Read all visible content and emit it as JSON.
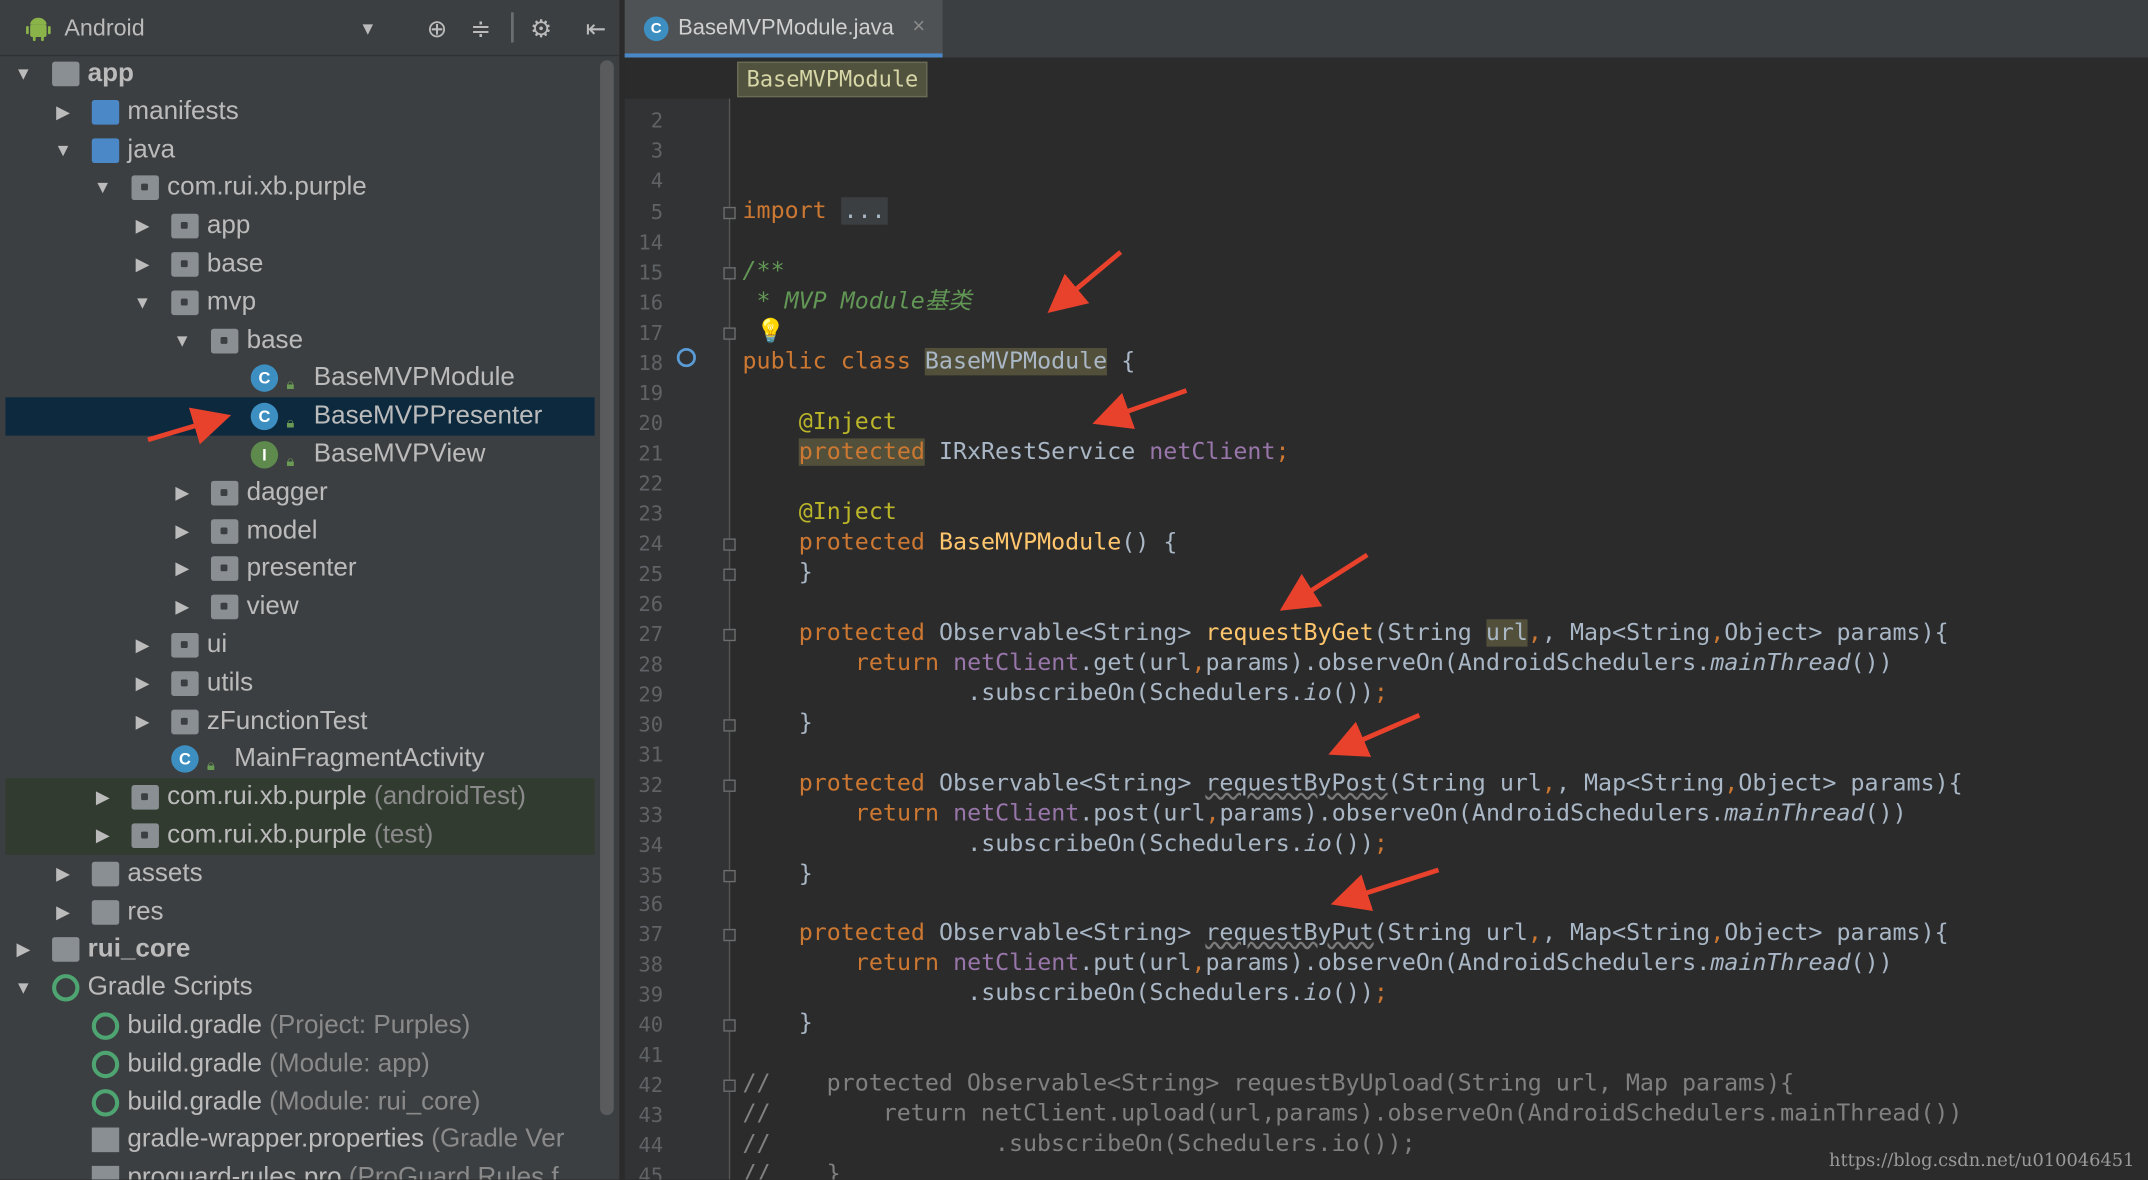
{
  "project_panel": {
    "view_mode": "Android",
    "toolbar_icons": [
      "target-icon",
      "collapse-icon",
      "gear-icon",
      "hide-panel-icon"
    ],
    "tree": [
      {
        "label": "app",
        "depth": 0,
        "arrow": "down",
        "icon": "module",
        "bold": true
      },
      {
        "label": "manifests",
        "depth": 1,
        "arrow": "right",
        "icon": "folder-blue"
      },
      {
        "label": "java",
        "depth": 1,
        "arrow": "down",
        "icon": "folder-blue"
      },
      {
        "label": "com.rui.xb.purple",
        "depth": 2,
        "arrow": "down",
        "icon": "package"
      },
      {
        "label": "app",
        "depth": 3,
        "arrow": "right",
        "icon": "package"
      },
      {
        "label": "base",
        "depth": 3,
        "arrow": "right",
        "icon": "package"
      },
      {
        "label": "mvp",
        "depth": 3,
        "arrow": "down",
        "icon": "package"
      },
      {
        "label": "base",
        "depth": 4,
        "arrow": "down",
        "icon": "package"
      },
      {
        "label": "BaseMVPModule",
        "depth": 5,
        "arrow": "",
        "icon": "class-c"
      },
      {
        "label": "BaseMVPPresenter",
        "depth": 5,
        "arrow": "",
        "icon": "class-c",
        "selected": true
      },
      {
        "label": "BaseMVPView",
        "depth": 5,
        "arrow": "",
        "icon": "class-i"
      },
      {
        "label": "dagger",
        "depth": 4,
        "arrow": "right",
        "icon": "package"
      },
      {
        "label": "model",
        "depth": 4,
        "arrow": "right",
        "icon": "package"
      },
      {
        "label": "presenter",
        "depth": 4,
        "arrow": "right",
        "icon": "package"
      },
      {
        "label": "view",
        "depth": 4,
        "arrow": "right",
        "icon": "package"
      },
      {
        "label": "ui",
        "depth": 3,
        "arrow": "right",
        "icon": "package"
      },
      {
        "label": "utils",
        "depth": 3,
        "arrow": "right",
        "icon": "package"
      },
      {
        "label": "zFunctionTest",
        "depth": 3,
        "arrow": "right",
        "icon": "package"
      },
      {
        "label": "MainFragmentActivity",
        "depth": 3,
        "arrow": "",
        "icon": "class-c"
      },
      {
        "label": "com.rui.xb.purple",
        "sub": "(androidTest)",
        "depth": 2,
        "arrow": "right",
        "icon": "package",
        "test": true
      },
      {
        "label": "com.rui.xb.purple",
        "sub": "(test)",
        "depth": 2,
        "arrow": "right",
        "icon": "package",
        "test": true
      },
      {
        "label": "assets",
        "depth": 1,
        "arrow": "right",
        "icon": "res-folder"
      },
      {
        "label": "res",
        "depth": 1,
        "arrow": "right",
        "icon": "res-folder"
      },
      {
        "label": "rui_core",
        "depth": 0,
        "arrow": "right",
        "icon": "module",
        "bold": true
      },
      {
        "label": "Gradle Scripts",
        "depth": 0,
        "arrow": "down",
        "icon": "gradle"
      },
      {
        "label": "build.gradle",
        "sub": "(Project: Purples)",
        "depth": 1,
        "arrow": "",
        "icon": "gradle"
      },
      {
        "label": "build.gradle",
        "sub": "(Module: app)",
        "depth": 1,
        "arrow": "",
        "icon": "gradle"
      },
      {
        "label": "build.gradle",
        "sub": "(Module: rui_core)",
        "depth": 1,
        "arrow": "",
        "icon": "gradle"
      },
      {
        "label": "gradle-wrapper.properties",
        "sub": "(Gradle Ver",
        "depth": 1,
        "arrow": "",
        "icon": "props"
      },
      {
        "label": "proguard-rules.pro",
        "sub": "(ProGuard Rules f",
        "depth": 1,
        "arrow": "",
        "icon": "props"
      }
    ]
  },
  "editor": {
    "tab": {
      "label": "BaseMVPModule.java"
    },
    "breadcrumb": "BaseMVPModule",
    "line_numbers": [
      "2",
      "3",
      "4",
      "5",
      "14",
      "15",
      "16",
      "17",
      "18",
      "19",
      "20",
      "21",
      "22",
      "23",
      "24",
      "25",
      "26",
      "27",
      "28",
      "29",
      "30",
      "31",
      "32",
      "33",
      "34",
      "35",
      "36",
      "37",
      "38",
      "39",
      "40",
      "41",
      "42",
      "43",
      "44",
      "45"
    ],
    "code": {
      "l5_import": "import",
      "l5_fold": "...",
      "l15": "/**",
      "l16": " * MVP Module基类",
      "l18_kw1": "public",
      "l18_kw2": "class",
      "l18_name": "BaseMVPModule",
      "l18_brace": " {",
      "inject": "@Inject",
      "protected": "protected",
      "l21_type": " IRxRestService ",
      "l21_field": "netClient",
      "l21_semi": ";",
      "l24_name": "BaseMVPModule",
      "l24_rest": "() {",
      "close_brace": "}",
      "observable": " Observable<String> ",
      "m_get": "requestByGet",
      "m_post": "requestByPost",
      "m_put": "requestByPut",
      "params_a": "(String ",
      "url": "url",
      "params_b": ", Map<String",
      "comma": ",",
      "params_c": "Object> params){",
      "return": "return",
      "net": "netClient",
      "get_call": ".get(url",
      "post_call": ".post(url",
      "put_call": ".put(url",
      "params_obs": "params).observeOn(AndroidSchedulers.",
      "main_thread": "mainThread",
      "call_end": "())",
      "sub_on": ".subscribeOn(Schedulers.",
      "io": "io",
      "sub_end": "())",
      "semi": ";",
      "c42": "//    protected Observable<String> requestByUpload(String url, Map params){",
      "c43": "//        return netClient.upload(url,params).observeOn(AndroidSchedulers.mainThread())",
      "c44": "//                .subscribeOn(Schedulers.io());",
      "c45": "//    }"
    }
  },
  "watermark": "https://blog.csdn.net/u010046451",
  "colors": {
    "background": "#2b2b2b",
    "panel": "#3c3f41",
    "selection": "#0d293e",
    "keyword": "#cc7832",
    "annotation": "#bbb529",
    "field": "#9876aa",
    "method": "#ffc66d",
    "doc_comment": "#629755",
    "arrow_annotation": "#e8412c"
  }
}
